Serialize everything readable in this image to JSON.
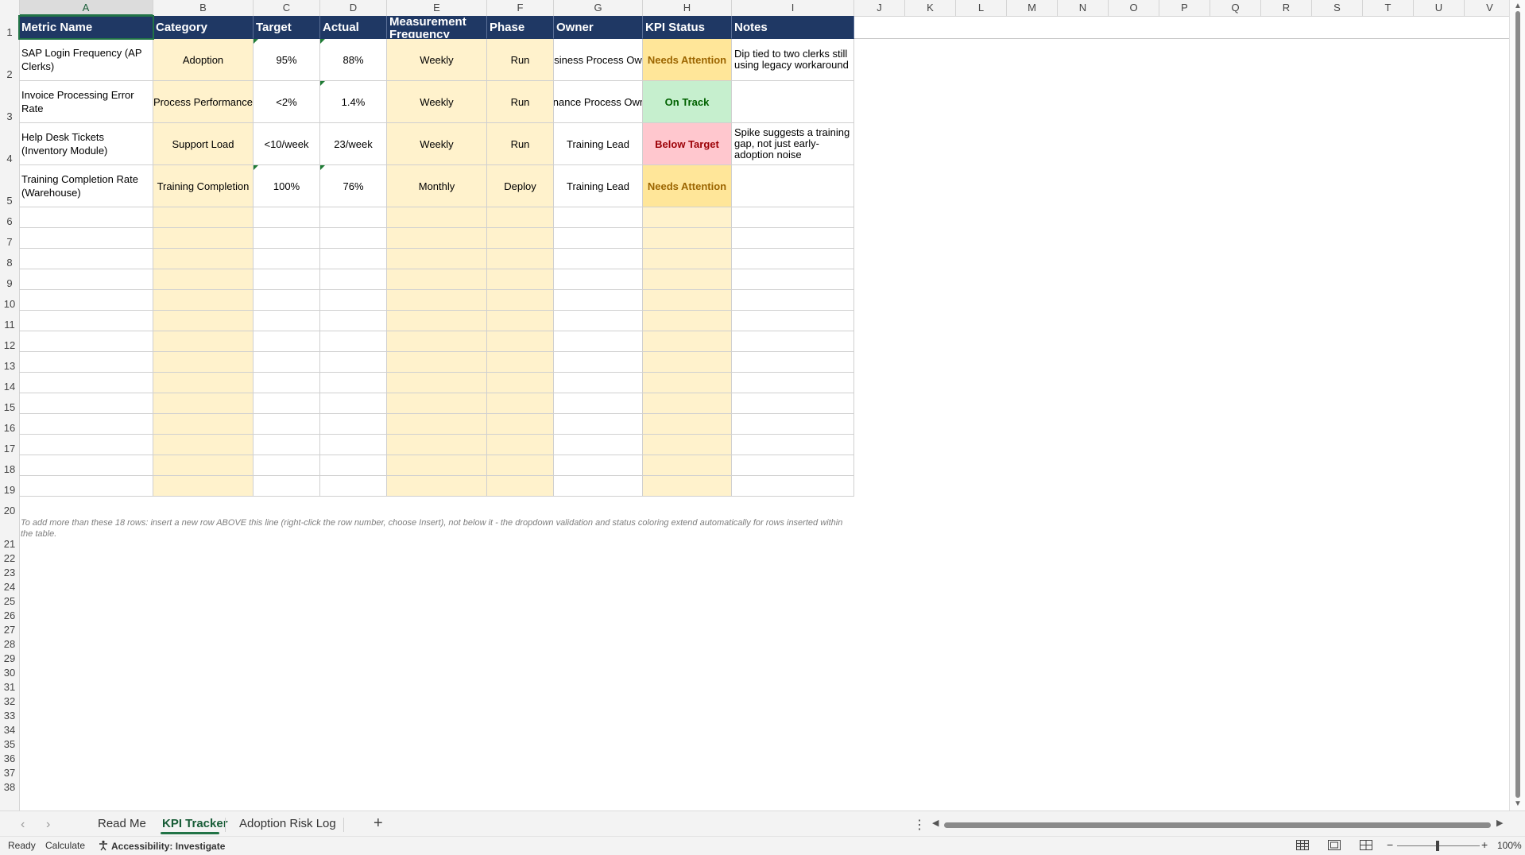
{
  "columns": [
    "A",
    "B",
    "C",
    "D",
    "E",
    "F",
    "G",
    "H",
    "I",
    "J",
    "K",
    "L",
    "M",
    "N",
    "O",
    "P",
    "Q",
    "R",
    "S",
    "T",
    "U",
    "V"
  ],
  "rows": [
    "1",
    "2",
    "3",
    "4",
    "5",
    "6",
    "7",
    "8",
    "9",
    "10",
    "11",
    "12",
    "13",
    "14",
    "15",
    "16",
    "17",
    "18",
    "19",
    "20",
    "21",
    "22",
    "23",
    "24",
    "25",
    "26",
    "27",
    "28",
    "29",
    "30",
    "31",
    "32",
    "33",
    "34",
    "35",
    "36",
    "37",
    "38"
  ],
  "headers": {
    "metric_name": "Metric Name",
    "category": "Category",
    "target": "Target",
    "actual": "Actual",
    "measurement_frequency": "Measurement Frequency",
    "phase": "Phase",
    "owner": "Owner",
    "kpi_status": "KPI Status",
    "notes": "Notes"
  },
  "kpis": [
    {
      "metric_name": "SAP Login Frequency (AP Clerks)",
      "category": "Adoption",
      "target": "95%",
      "actual": "88%",
      "frequency": "Weekly",
      "phase": "Run",
      "owner": "siness Process Ow",
      "status": "Needs Attention",
      "notes": "Dip tied to two clerks still using legacy workaround"
    },
    {
      "metric_name": "Invoice Processing Error Rate",
      "category": "Process Performance",
      "target": "<2%",
      "actual": "1.4%",
      "frequency": "Weekly",
      "phase": "Run",
      "owner": "nance Process Owr",
      "status": "On Track",
      "notes": ""
    },
    {
      "metric_name": "Help Desk Tickets (Inventory Module)",
      "category": "Support Load",
      "target": "<10/week",
      "actual": "23/week",
      "frequency": "Weekly",
      "phase": "Run",
      "owner": "Training Lead",
      "status": "Below Target",
      "notes": "Spike suggests a training gap, not just early-adoption noise"
    },
    {
      "metric_name": "Training Completion Rate (Warehouse)",
      "category": "Training Completion",
      "target": "100%",
      "actual": "76%",
      "frequency": "Monthly",
      "phase": "Deploy",
      "owner": "Training Lead",
      "status": "Needs Attention",
      "notes": ""
    }
  ],
  "status_colors": {
    "Needs Attention": {
      "bg": "#ffe699",
      "fg": "#9c6500"
    },
    "On Track": {
      "bg": "#c6efce",
      "fg": "#006100"
    },
    "Below Target": {
      "bg": "#ffc7ce",
      "fg": "#9c0006"
    }
  },
  "instruction_note": "To add more than these 18 rows: insert a new row ABOVE this line (right-click the row number, choose Insert), not below it - the dropdown validation and status coloring extend automatically for rows inserted within the table.",
  "sheet_tabs": {
    "read_me": "Read Me",
    "kpi_tracker": "KPI Tracker",
    "adoption_risk_log": "Adoption Risk Log",
    "add": "+"
  },
  "status_bar": {
    "ready": "Ready",
    "calculate": "Calculate",
    "accessibility": "Accessibility: Investigate",
    "zoom": "100%"
  },
  "colors": {
    "header_fill": "#1f3864",
    "input_fill": "#fff2cc",
    "accent": "#217346"
  }
}
